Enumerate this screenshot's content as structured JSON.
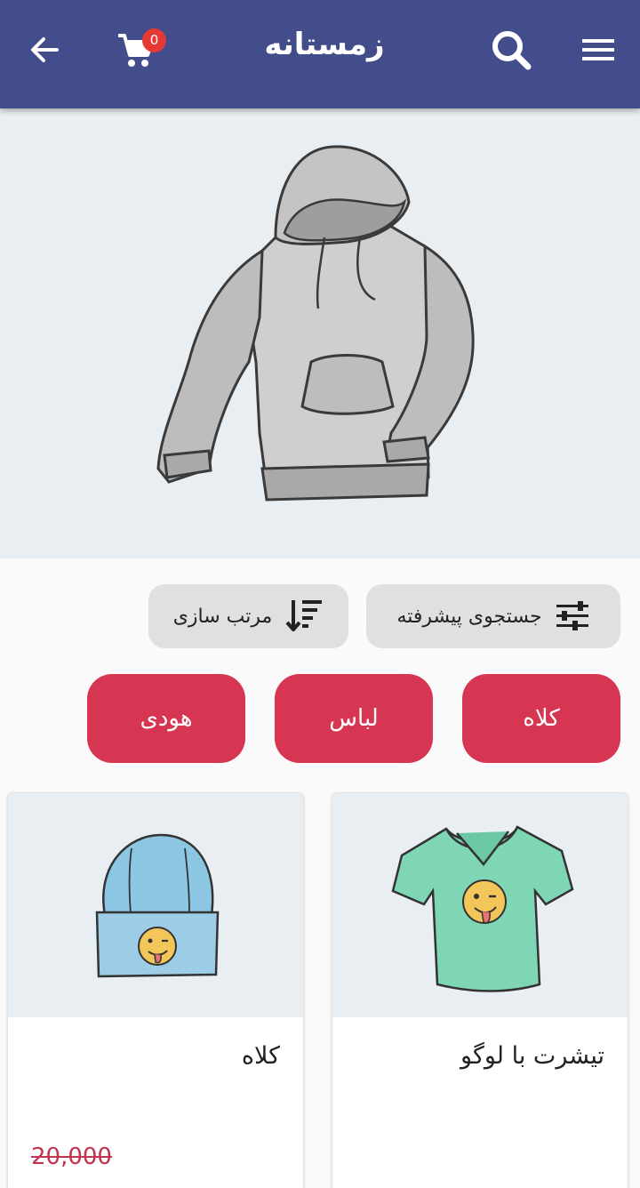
{
  "appbar": {
    "title": "زمستانه",
    "cart_count": "0",
    "icons": {
      "back": "arrow-left-icon",
      "cart": "cart-icon",
      "search": "search-icon",
      "menu": "menu-icon"
    },
    "color": "#444d8c"
  },
  "hero": {
    "image": "hoodie-illustration",
    "background": "#e9eef3"
  },
  "actions": {
    "advanced_search_label": "جستجوی پیشرفته",
    "sort_label": "مرتب سازی"
  },
  "categories": [
    "کلاه",
    "لباس",
    "هودی"
  ],
  "category_color": "#d63651",
  "products": [
    {
      "name": "تیشرت با لوگو",
      "image": "tshirt-illustration"
    },
    {
      "name": "کلاه",
      "image": "beanie-illustration",
      "old_price": "20,000"
    }
  ]
}
